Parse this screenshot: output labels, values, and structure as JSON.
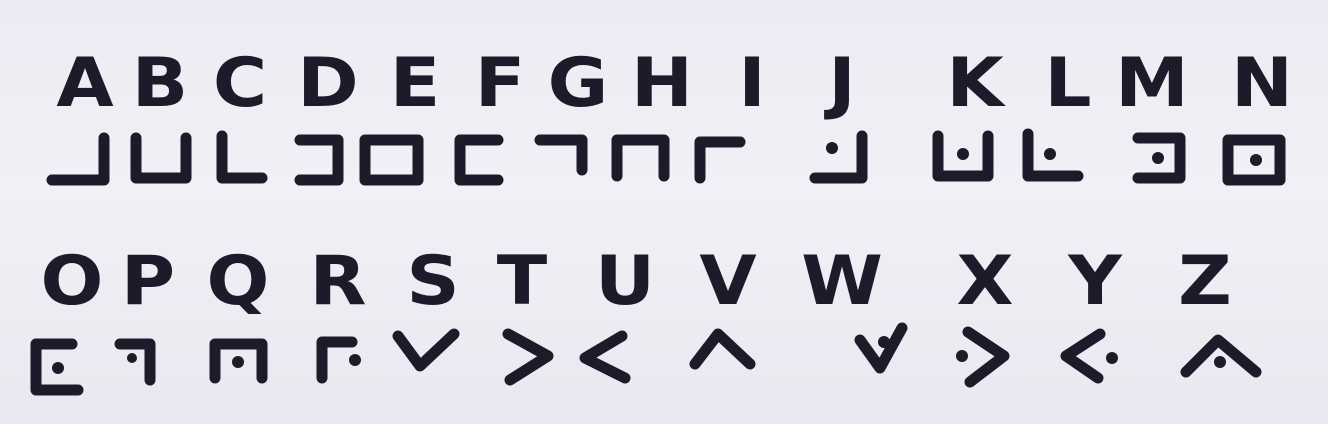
{
  "alphabet_top": [
    "A",
    "B",
    "C",
    "D",
    "E",
    "F",
    "G",
    "H",
    "I",
    "J",
    "K",
    "L",
    "M",
    "N"
  ],
  "alphabet_bottom": [
    "O",
    "P",
    "Q",
    "R",
    "S",
    "T",
    "U",
    "V",
    "W",
    "X",
    "Y",
    "Z"
  ],
  "ink_color": "#1d1a2a",
  "paper_color": "#efeef5"
}
